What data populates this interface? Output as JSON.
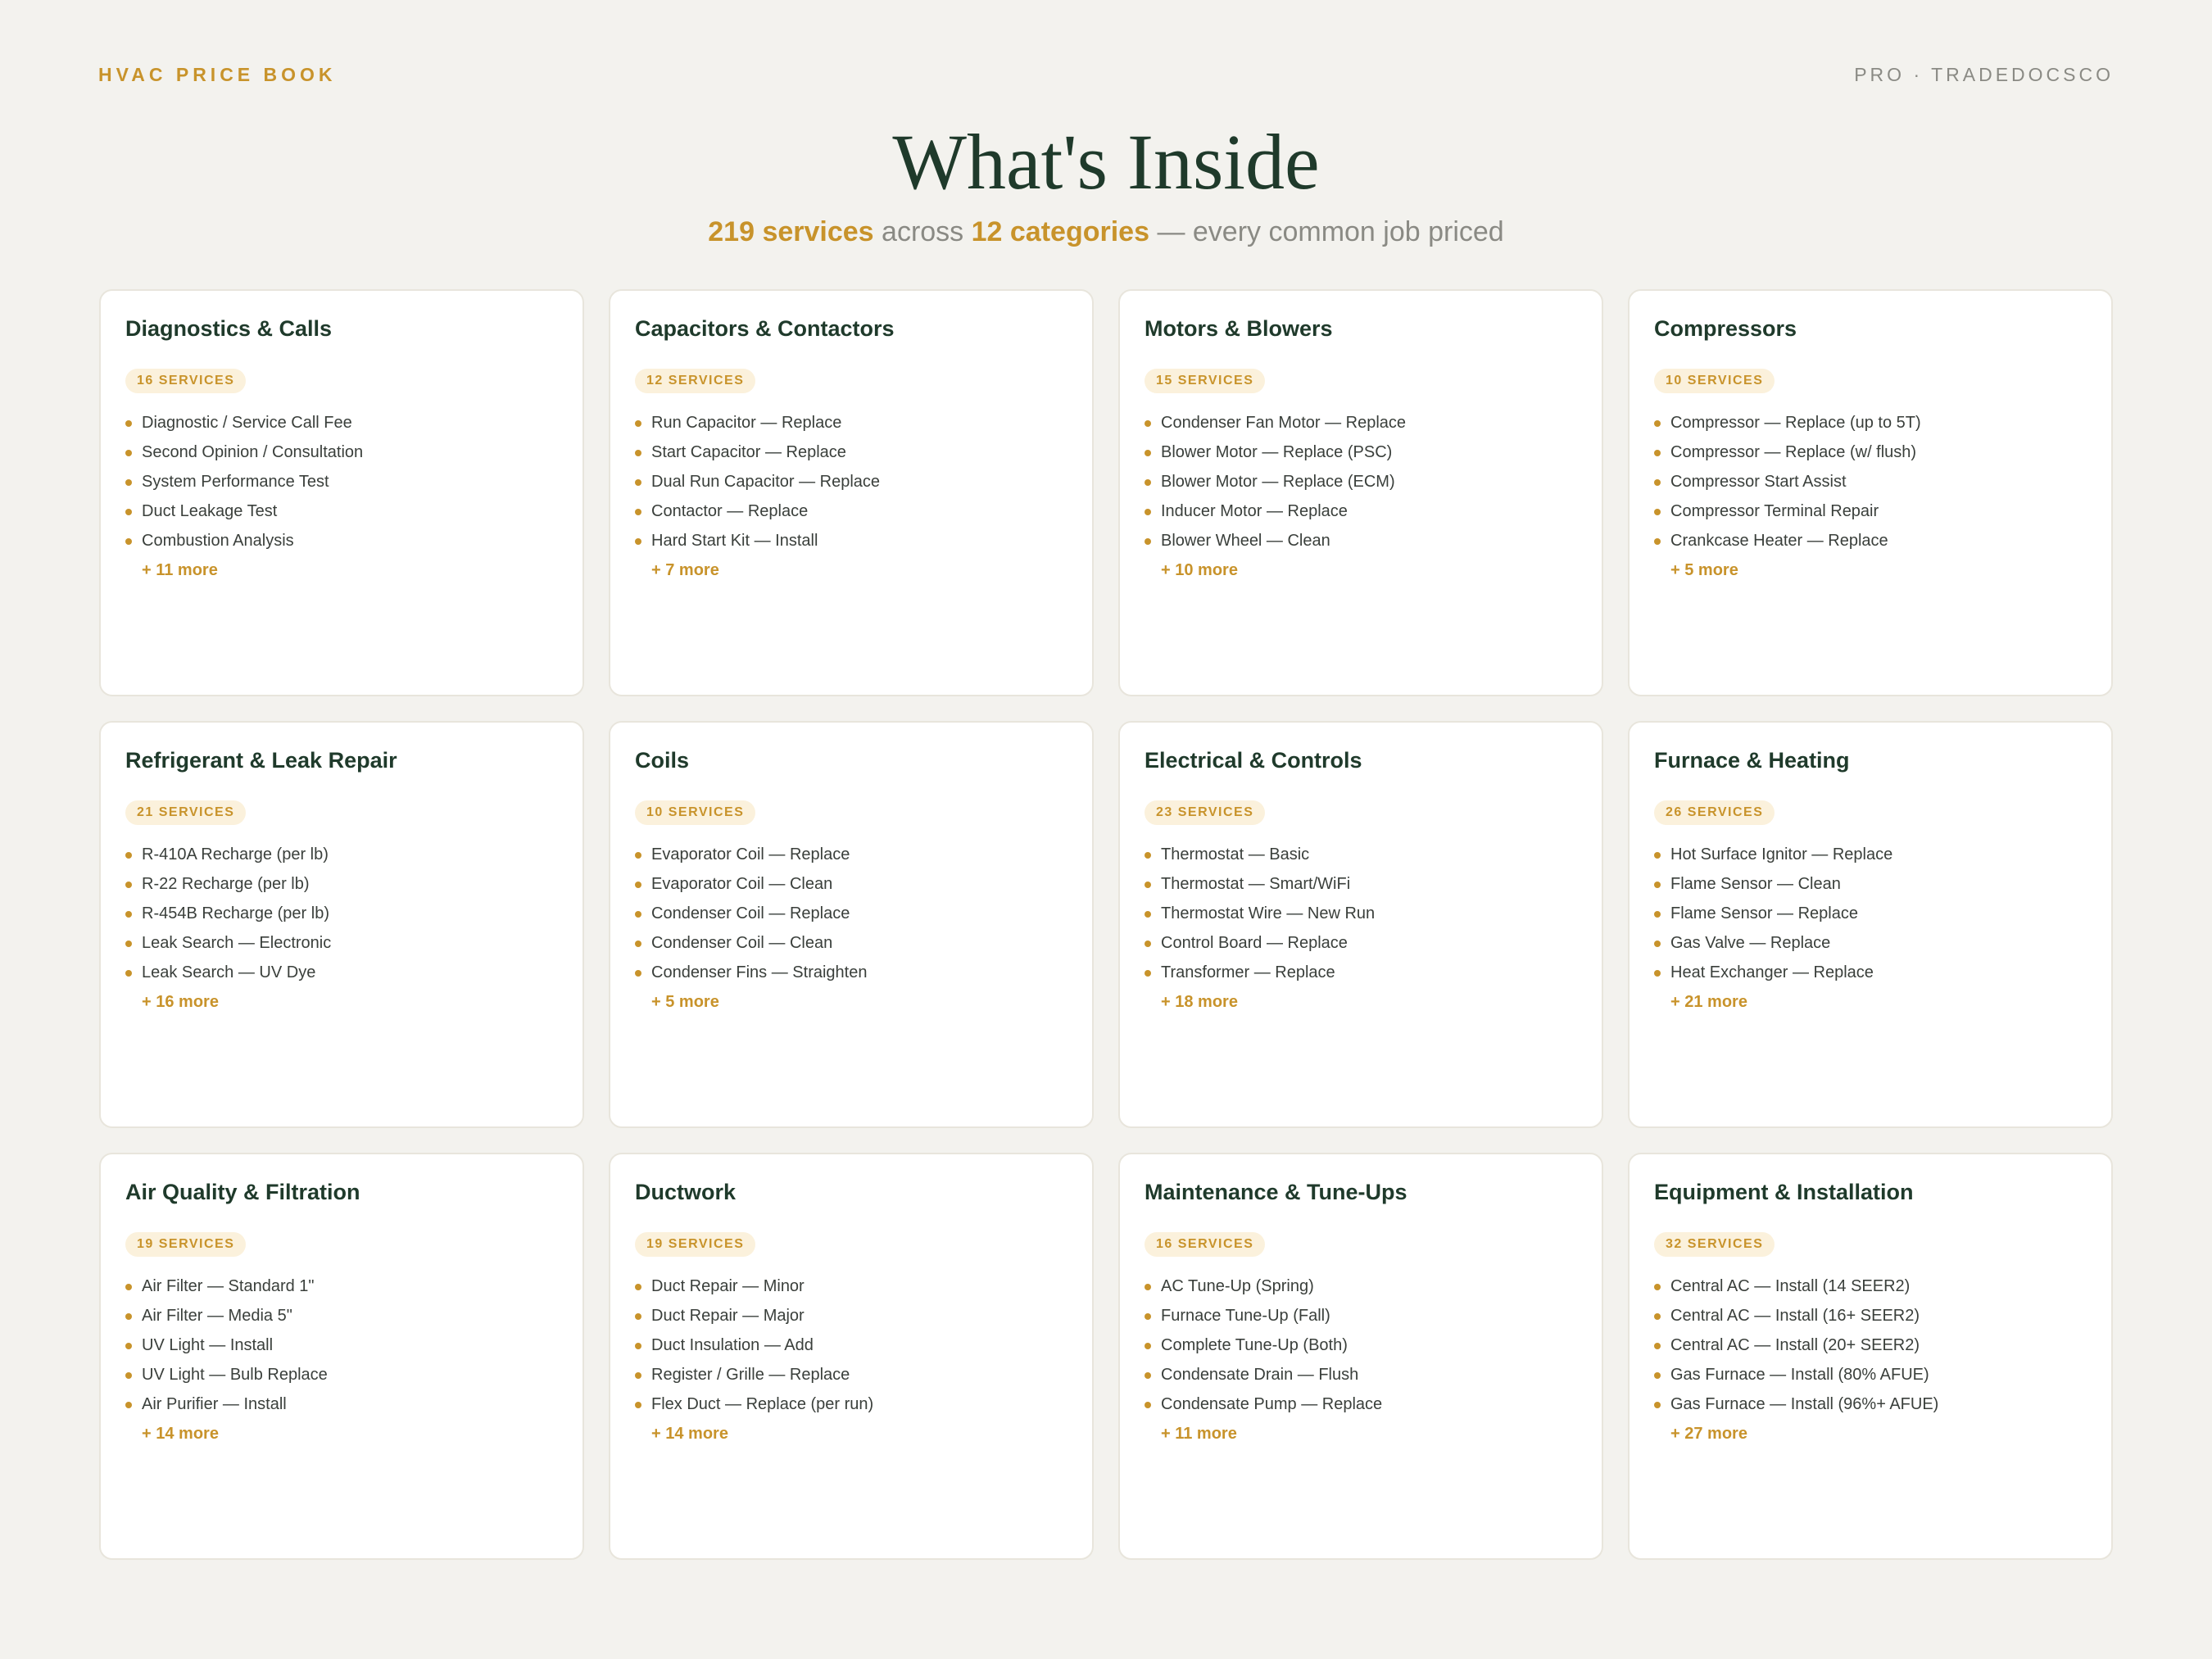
{
  "header": {
    "brand": "HVAC PRICE BOOK",
    "pro": "PRO · TRADEDOCSCO",
    "title": "What's Inside",
    "subtitle": {
      "services": "219 services",
      "across": "across",
      "categories": "12 categories",
      "tail": "— every common job priced"
    }
  },
  "colors": {
    "accent": "#c8932b",
    "title": "#1f3a2b",
    "background": "#f3f2ee"
  },
  "categories": [
    {
      "title": "Diagnostics & Calls",
      "badge": "16 SERVICES",
      "items": [
        "Diagnostic / Service Call Fee",
        "Second Opinion / Consultation",
        "System Performance Test",
        "Duct Leakage Test",
        "Combustion Analysis"
      ],
      "more": "+ 11 more"
    },
    {
      "title": "Capacitors & Contactors",
      "badge": "12 SERVICES",
      "items": [
        "Run Capacitor — Replace",
        "Start Capacitor — Replace",
        "Dual Run Capacitor — Replace",
        "Contactor — Replace",
        "Hard Start Kit — Install"
      ],
      "more": "+ 7 more"
    },
    {
      "title": "Motors & Blowers",
      "badge": "15 SERVICES",
      "items": [
        "Condenser Fan Motor — Replace",
        "Blower Motor — Replace (PSC)",
        "Blower Motor — Replace (ECM)",
        "Inducer Motor — Replace",
        "Blower Wheel — Clean"
      ],
      "more": "+ 10 more"
    },
    {
      "title": "Compressors",
      "badge": "10 SERVICES",
      "items": [
        "Compressor — Replace (up to 5T)",
        "Compressor — Replace (w/ flush)",
        "Compressor Start Assist",
        "Compressor Terminal Repair",
        "Crankcase Heater — Replace"
      ],
      "more": "+ 5 more"
    },
    {
      "title": "Refrigerant & Leak Repair",
      "badge": "21 SERVICES",
      "items": [
        "R-410A Recharge (per lb)",
        "R-22 Recharge (per lb)",
        "R-454B Recharge (per lb)",
        "Leak Search — Electronic",
        "Leak Search — UV Dye"
      ],
      "more": "+ 16 more"
    },
    {
      "title": "Coils",
      "badge": "10 SERVICES",
      "items": [
        "Evaporator Coil — Replace",
        "Evaporator Coil — Clean",
        "Condenser Coil — Replace",
        "Condenser Coil — Clean",
        "Condenser Fins — Straighten"
      ],
      "more": "+ 5 more"
    },
    {
      "title": "Electrical & Controls",
      "badge": "23 SERVICES",
      "items": [
        "Thermostat — Basic",
        "Thermostat — Smart/WiFi",
        "Thermostat Wire — New Run",
        "Control Board — Replace",
        "Transformer — Replace"
      ],
      "more": "+ 18 more"
    },
    {
      "title": "Furnace & Heating",
      "badge": "26 SERVICES",
      "items": [
        "Hot Surface Ignitor — Replace",
        "Flame Sensor — Clean",
        "Flame Sensor — Replace",
        "Gas Valve — Replace",
        "Heat Exchanger — Replace"
      ],
      "more": "+ 21 more"
    },
    {
      "title": "Air Quality & Filtration",
      "badge": "19 SERVICES",
      "items": [
        "Air Filter — Standard 1\"",
        "Air Filter — Media 5\"",
        "UV Light — Install",
        "UV Light — Bulb Replace",
        "Air Purifier — Install"
      ],
      "more": "+ 14 more"
    },
    {
      "title": "Ductwork",
      "badge": "19 SERVICES",
      "items": [
        "Duct Repair — Minor",
        "Duct Repair — Major",
        "Duct Insulation — Add",
        "Register / Grille — Replace",
        "Flex Duct — Replace (per run)"
      ],
      "more": "+ 14 more"
    },
    {
      "title": "Maintenance & Tune-Ups",
      "badge": "16 SERVICES",
      "items": [
        "AC Tune-Up (Spring)",
        "Furnace Tune-Up (Fall)",
        "Complete Tune-Up (Both)",
        "Condensate Drain — Flush",
        "Condensate Pump — Replace"
      ],
      "more": "+ 11 more"
    },
    {
      "title": "Equipment & Installation",
      "badge": "32 SERVICES",
      "items": [
        "Central AC — Install (14 SEER2)",
        "Central AC — Install (16+ SEER2)",
        "Central AC — Install (20+ SEER2)",
        "Gas Furnace — Install (80% AFUE)",
        "Gas Furnace — Install (96%+ AFUE)"
      ],
      "more": "+ 27 more"
    }
  ]
}
